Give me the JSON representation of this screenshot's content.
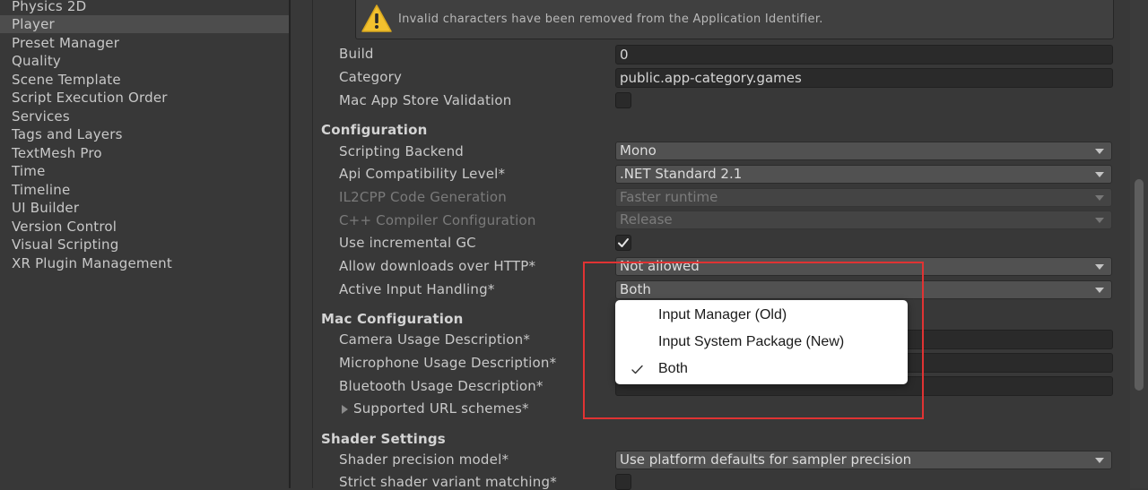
{
  "sidebar": {
    "items": [
      {
        "label": "Physics 2D",
        "selected": false
      },
      {
        "label": "Player",
        "selected": true
      },
      {
        "label": "Preset Manager",
        "selected": false
      },
      {
        "label": "Quality",
        "selected": false
      },
      {
        "label": "Scene Template",
        "selected": false
      },
      {
        "label": "Script Execution Order",
        "selected": false
      },
      {
        "label": "Services",
        "selected": false
      },
      {
        "label": "Tags and Layers",
        "selected": false
      },
      {
        "label": "TextMesh Pro",
        "selected": false
      },
      {
        "label": "Time",
        "selected": false
      },
      {
        "label": "Timeline",
        "selected": false
      },
      {
        "label": "UI Builder",
        "selected": false
      },
      {
        "label": "Version Control",
        "selected": false
      },
      {
        "label": "Visual Scripting",
        "selected": false
      },
      {
        "label": "XR Plugin Management",
        "selected": false
      }
    ]
  },
  "warning": {
    "icon": "warning-triangle-icon",
    "text": "Invalid characters have been removed from the Application Identifier."
  },
  "identification": {
    "build_label": "Build",
    "build_value": "0",
    "category_label": "Category",
    "category_value": "public.app-category.games",
    "mac_validation_label": "Mac App Store Validation",
    "mac_validation_checked": false
  },
  "configuration": {
    "header": "Configuration",
    "scripting_backend_label": "Scripting Backend",
    "scripting_backend_value": "Mono",
    "api_level_label": "Api Compatibility Level*",
    "api_level_value": ".NET Standard 2.1",
    "il2cpp_label": "IL2CPP Code Generation",
    "il2cpp_value": "Faster runtime",
    "cpp_compiler_label": "C++ Compiler Configuration",
    "cpp_compiler_value": "Release",
    "incremental_gc_label": "Use incremental GC",
    "incremental_gc_checked": true,
    "downloads_http_label": "Allow downloads over HTTP*",
    "downloads_http_value": "Not allowed",
    "input_handling_label": "Active Input Handling*",
    "input_handling_value": "Both"
  },
  "input_menu": {
    "options": [
      {
        "label": "Input Manager (Old)",
        "checked": false
      },
      {
        "label": "Input System Package (New)",
        "checked": false
      },
      {
        "label": "Both",
        "checked": true
      }
    ]
  },
  "mac_configuration": {
    "header": "Mac Configuration",
    "camera_label": "Camera Usage Description*",
    "microphone_label": "Microphone Usage Description*",
    "bluetooth_label": "Bluetooth Usage Description*",
    "url_schemes_label": "Supported URL schemes*"
  },
  "shader_settings": {
    "header": "Shader Settings",
    "precision_label": "Shader precision model*",
    "precision_value": "Use platform defaults for sampler precision",
    "strict_label": "Strict shader variant matching*"
  },
  "colors": {
    "highlight_box": "#e03333",
    "warning_icon": "#f2c12e"
  }
}
